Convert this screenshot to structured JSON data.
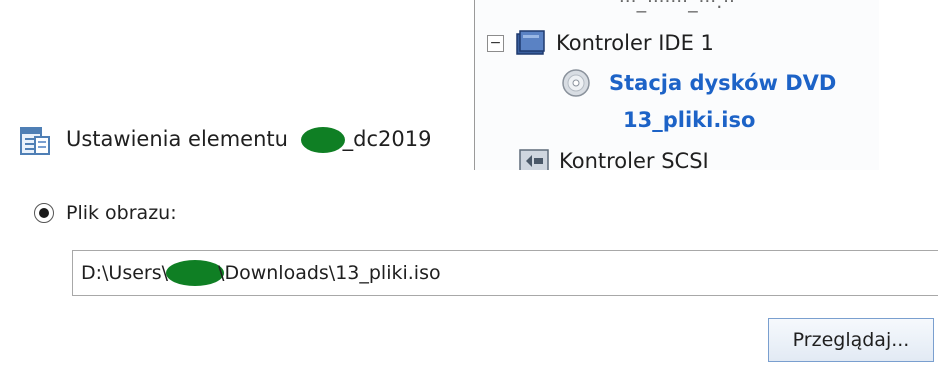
{
  "settings": {
    "title_prefix": "Ustawienia elementu ",
    "title_suffix": "_dc2019"
  },
  "tree": {
    "cut_text": "ᐧᐧᐧ_ᐧᐧᐧᐧᐧᐧᐧ_ᐧᐧᐧ.ᐧᐧ",
    "collapse_symbol": "−",
    "ide_controller": "Kontroler IDE 1",
    "dvd_line1": "Stacja dysków DVD",
    "dvd_line2": "13_pliki.iso",
    "scsi_controller": "Kontroler SCSI"
  },
  "image_option": {
    "label": "Plik obrazu:",
    "selected": true,
    "path_prefix": "D:\\Users\\",
    "path_suffix": "\\Downloads\\13_pliki.iso"
  },
  "browse": {
    "label": "Przeglądaj..."
  },
  "colors": {
    "link": "#1d63c7",
    "redaction": "#0f7f24"
  },
  "icons": [
    "settings-document-icon",
    "ide-controller-icon",
    "dvd-drive-icon",
    "scsi-controller-icon"
  ]
}
